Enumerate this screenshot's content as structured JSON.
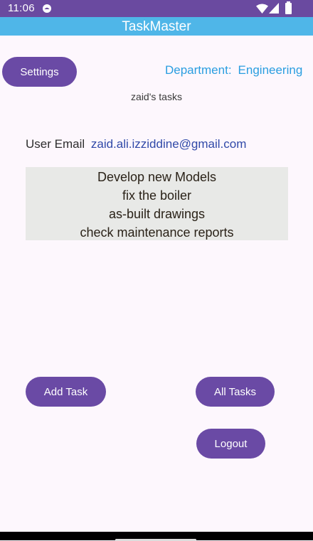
{
  "status_bar": {
    "time": "11:06",
    "icons": [
      "app-notification-icon",
      "wifi-icon",
      "signal-icon",
      "battery-icon"
    ]
  },
  "app_bar": {
    "title": "TaskMaster"
  },
  "settings_button": {
    "label": "Settings"
  },
  "department": {
    "label": "Department:",
    "value": "Engineering"
  },
  "tasks_header": "zaid's tasks",
  "user": {
    "email_label": "User Email",
    "email": "zaid.ali.izziddine@gmail.com"
  },
  "tasks": [
    "Develop new Models",
    "fix the boiler",
    "as-built drawings",
    "check maintenance reports"
  ],
  "buttons": {
    "add_task": "Add Task",
    "all_tasks": "All Tasks",
    "logout": "Logout"
  },
  "colors": {
    "status_bar": "#6a4aa0",
    "app_bar": "#4fb6e8",
    "button": "#6a4aa5",
    "department_text": "#2a9ee0",
    "email_text": "#3049a8",
    "task_list_bg": "#e8e9e7",
    "background": "#fdf7fd"
  }
}
